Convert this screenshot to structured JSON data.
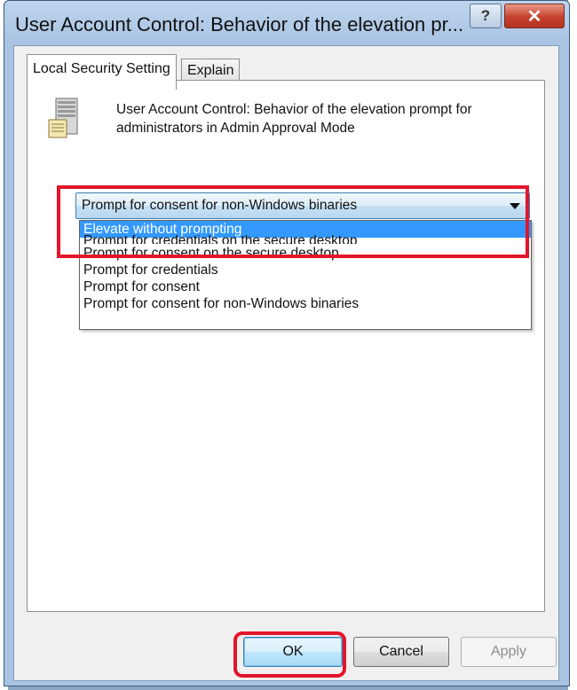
{
  "window": {
    "title": "User Account Control: Behavior of the elevation pr...",
    "help_label": "?",
    "close_label": "✕"
  },
  "tabs": [
    {
      "label": "Local Security Setting",
      "active": true
    },
    {
      "label": "Explain",
      "active": false
    }
  ],
  "policy": {
    "icon": "server-icon",
    "title": "User Account Control: Behavior of the elevation prompt for administrators in Admin Approval Mode"
  },
  "combo": {
    "selected": "Prompt for consent for non-Windows binaries",
    "options": [
      "Elevate without prompting",
      "Prompt for credentials on the secure desktop",
      "Prompt for consent on the secure desktop",
      "Prompt for credentials",
      "Prompt for consent",
      "Prompt for consent for non-Windows binaries"
    ],
    "highlighted_index": 0
  },
  "buttons": {
    "ok": "OK",
    "cancel": "Cancel",
    "apply": "Apply"
  },
  "annotation_color": "#e3152b"
}
